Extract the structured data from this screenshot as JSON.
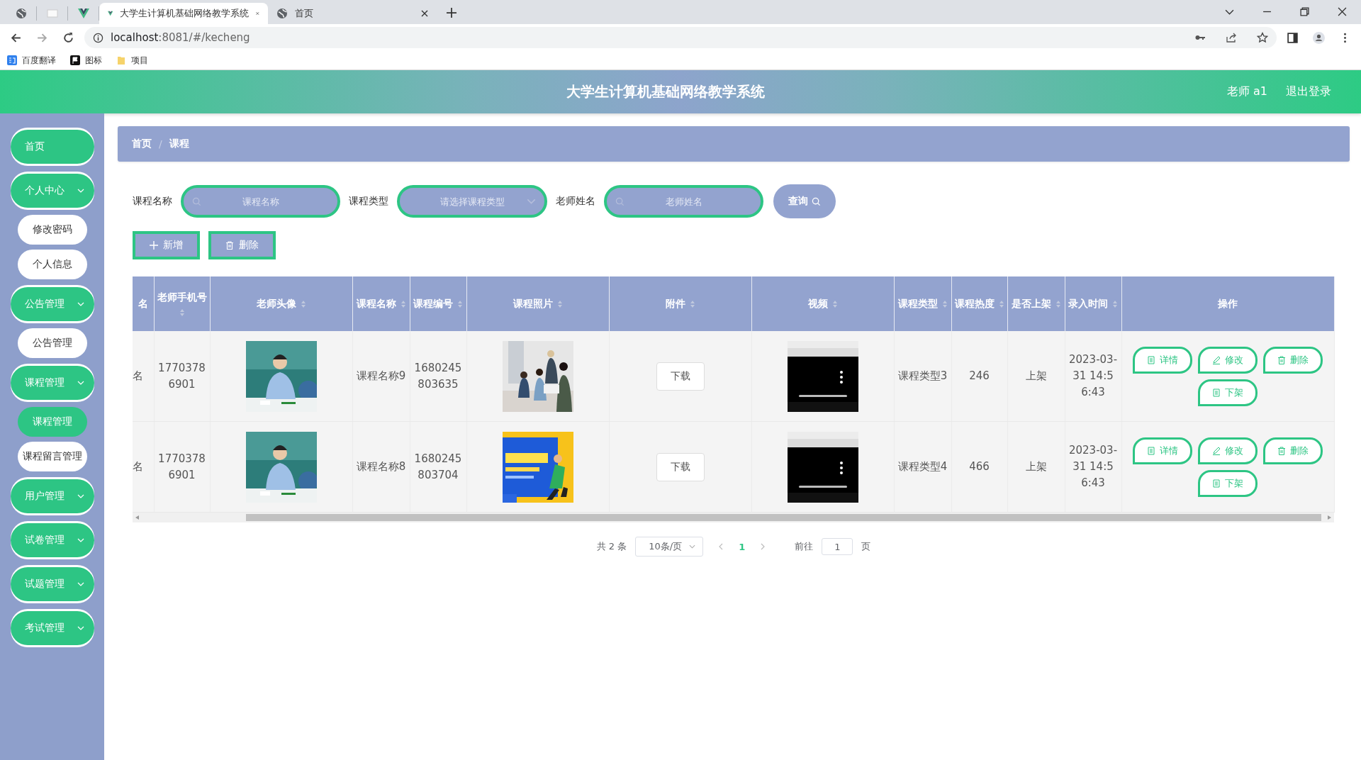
{
  "browser": {
    "tabs": [
      {
        "kind": "globe",
        "selected": false
      },
      {
        "kind": "blank",
        "selected": false
      },
      {
        "kind": "vue",
        "selected": false
      },
      {
        "kind": "vue",
        "title": "大学生计算机基础网络教学系统",
        "selected": true
      },
      {
        "kind": "globe",
        "title": "首页",
        "selected": false
      }
    ],
    "url_host": "localhost",
    "url_rest": ":8081/#/kecheng",
    "bookmarks": [
      {
        "kind": "translate",
        "label": "百度翻译"
      },
      {
        "kind": "flag",
        "label": "图标"
      },
      {
        "kind": "folder",
        "label": "项目"
      }
    ]
  },
  "header": {
    "title": "大学生计算机基础网络教学系统",
    "user": "老师 a1",
    "logout": "退出登录"
  },
  "sidebar": {
    "items": [
      {
        "label": "首页",
        "kind": "link",
        "selected": false
      },
      {
        "label": "个人中心",
        "kind": "group",
        "selected": false,
        "children": [
          {
            "label": "修改密码",
            "selected": false
          },
          {
            "label": "个人信息",
            "selected": false
          }
        ]
      },
      {
        "label": "公告管理",
        "kind": "group",
        "selected": false,
        "children": [
          {
            "label": "公告管理",
            "selected": false
          }
        ]
      },
      {
        "label": "课程管理",
        "kind": "group",
        "selected": false,
        "children": [
          {
            "label": "课程管理",
            "selected": true
          },
          {
            "label": "课程留言管理",
            "selected": false
          }
        ]
      },
      {
        "label": "用户管理",
        "kind": "group",
        "selected": false
      },
      {
        "label": "试卷管理",
        "kind": "group",
        "selected": false
      },
      {
        "label": "试题管理",
        "kind": "group",
        "selected": false
      },
      {
        "label": "考试管理",
        "kind": "group",
        "selected": false
      }
    ]
  },
  "breadcrumb": {
    "separator": "/",
    "items": [
      "首页",
      "课程"
    ]
  },
  "search": {
    "fields": [
      {
        "label": "课程名称",
        "kind": "input",
        "placeholder": "课程名称"
      },
      {
        "label": "课程类型",
        "kind": "select",
        "placeholder": "请选择课程类型"
      },
      {
        "label": "老师姓名",
        "kind": "input",
        "placeholder": "老师姓名"
      }
    ],
    "button": "查询"
  },
  "actions": [
    {
      "kind": "add",
      "label": "新增"
    },
    {
      "kind": "delete",
      "label": "删除"
    }
  ],
  "table": {
    "columns": [
      {
        "label": "名"
      },
      {
        "label": "老师手机号",
        "sortable": true
      },
      {
        "label": "老师头像",
        "sortable": true
      },
      {
        "label": "课程名称",
        "sortable": true
      },
      {
        "label": "课程编号",
        "sortable": true
      },
      {
        "label": "课程照片",
        "sortable": true
      },
      {
        "label": "附件",
        "sortable": true
      },
      {
        "label": "视频",
        "sortable": true
      },
      {
        "label": "课程类型",
        "sortable": true
      },
      {
        "label": "课程热度",
        "sortable": true
      },
      {
        "label": "是否上架",
        "sortable": true
      },
      {
        "label": "录入时间",
        "sortable": true
      },
      {
        "label": "操作"
      }
    ],
    "rows": [
      {
        "name_cut": "名",
        "phone": "17703786901",
        "course_name": "课程名称9",
        "course_code": "1680245803635",
        "attachment": "下载",
        "course_type": "课程类型3",
        "heat": "246",
        "online": "上架",
        "created": "2023-03-31 14:56:43",
        "actions": [
          {
            "kind": "detail",
            "label": "详情"
          },
          {
            "kind": "edit",
            "label": "修改"
          },
          {
            "kind": "delete",
            "label": "删除"
          },
          {
            "kind": "unlist",
            "label": "下架"
          }
        ]
      },
      {
        "name_cut": "名",
        "phone": "17703786901",
        "course_name": "课程名称8",
        "course_code": "1680245803704",
        "attachment": "下载",
        "course_type": "课程类型4",
        "heat": "466",
        "online": "上架",
        "created": "2023-03-31 14:56:43",
        "actions": [
          {
            "kind": "detail",
            "label": "详情"
          },
          {
            "kind": "edit",
            "label": "修改"
          },
          {
            "kind": "delete",
            "label": "删除"
          },
          {
            "kind": "unlist",
            "label": "下架"
          }
        ]
      }
    ]
  },
  "pagination": {
    "total": "共 2 条",
    "page_size": "10条/页",
    "pages": [
      {
        "label": "1",
        "selected": true
      }
    ],
    "goto_label": "前往",
    "goto_value": "1",
    "goto_suffix": "页"
  }
}
